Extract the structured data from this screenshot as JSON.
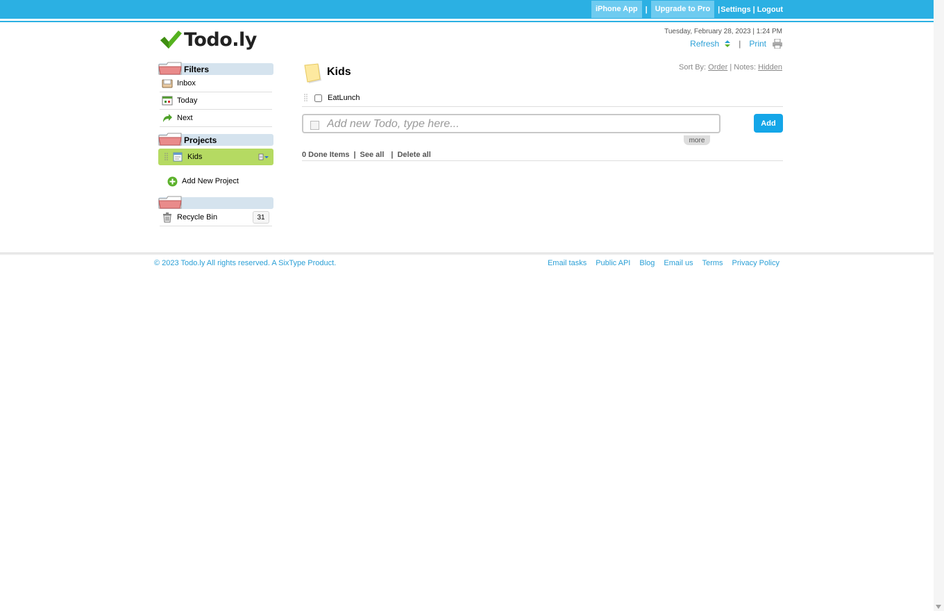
{
  "topbar": {
    "iphone_app": "iPhone App",
    "upgrade": "Upgrade to Pro",
    "settings": "Settings",
    "logout": "Logout"
  },
  "header": {
    "logo_text": "Todo.ly",
    "datetime": "Tuesday, February 28, 2023 | 1:24 PM",
    "refresh": "Refresh",
    "print": "Print"
  },
  "sidebar": {
    "filters_title": "Filters",
    "filters": [
      {
        "label": "Inbox",
        "icon": "inbox-icon"
      },
      {
        "label": "Today",
        "icon": "calendar-today-icon"
      },
      {
        "label": "Next",
        "icon": "arrow-next-icon"
      }
    ],
    "projects_title": "Projects",
    "projects": [
      {
        "label": "Kids",
        "icon": "project-doc-icon",
        "selected": true
      }
    ],
    "add_project": "Add New Project",
    "recycle_bin": "Recycle Bin",
    "recycle_count": "31"
  },
  "main": {
    "project_title": "Kids",
    "sort_by_label": "Sort By:",
    "sort_by_value": "Order",
    "notes_label": "Notes:",
    "notes_value": "Hidden",
    "tasks": [
      {
        "label": "EatLunch",
        "done": false
      }
    ],
    "new_todo_placeholder": "Add new Todo, type here...",
    "more_label": "more",
    "add_label": "Add",
    "done_items": "0 Done Items",
    "see_all": "See all",
    "delete_all": "Delete all"
  },
  "footer": {
    "copyright": "© 2023 Todo.ly All rights reserved. A SixType Product.",
    "links": [
      "Email tasks",
      "Public API",
      "Blog",
      "Email us",
      "Terms",
      "Privacy Policy"
    ]
  },
  "colors": {
    "topbar": "#2bb0e3",
    "accent_link": "#2a9fd6",
    "selected_project": "#b5da62",
    "add_button": "#14a6e8"
  }
}
